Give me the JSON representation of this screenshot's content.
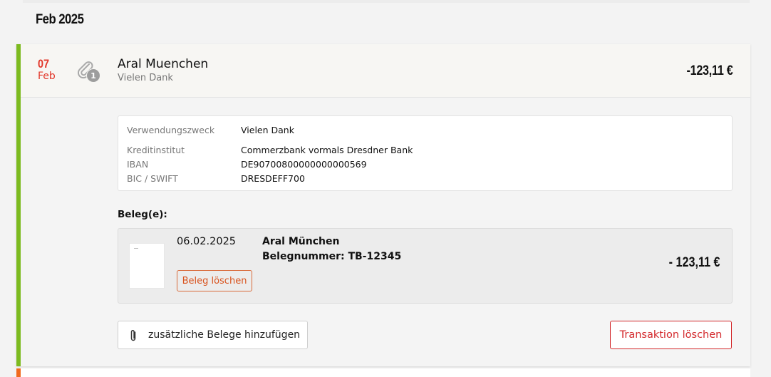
{
  "month_heading": "Feb 2025",
  "transaction": {
    "date_day": "07",
    "date_month": "Feb",
    "attachment_count": "1",
    "merchant": "Aral Muenchen",
    "subtitle": "Vielen Dank",
    "amount": "-123,11 €",
    "status_color": "#7cba1f"
  },
  "details": {
    "purpose_label": "Verwendungszweck",
    "purpose_value": "Vielen Dank",
    "bank_label": "Kreditinstitut",
    "bank_value": "Commerzbank vormals Dresdner Bank",
    "iban_label": "IBAN",
    "iban_value": "DE90700800000000000569",
    "bic_label": "BIC / SWIFT",
    "bic_value": "DRESDEFF700"
  },
  "receipts": {
    "label": "Beleg(e):",
    "items": [
      {
        "date": "06.02.2025",
        "merchant": "Aral München",
        "number": "Belegnummer: TB-12345",
        "amount": "- 123,11 €",
        "delete_label": "Beleg löschen"
      }
    ]
  },
  "actions": {
    "add_receipts_label": "zusätzliche Belege hinzufügen",
    "add_receipts_icon": "paperclip-icon",
    "delete_transaction_label": "Transaktion löschen"
  },
  "colors": {
    "accent_green": "#7cba1f",
    "date_red": "#e2372a",
    "danger_red": "#d3282b",
    "next_card_orange": "#f06a1d"
  }
}
